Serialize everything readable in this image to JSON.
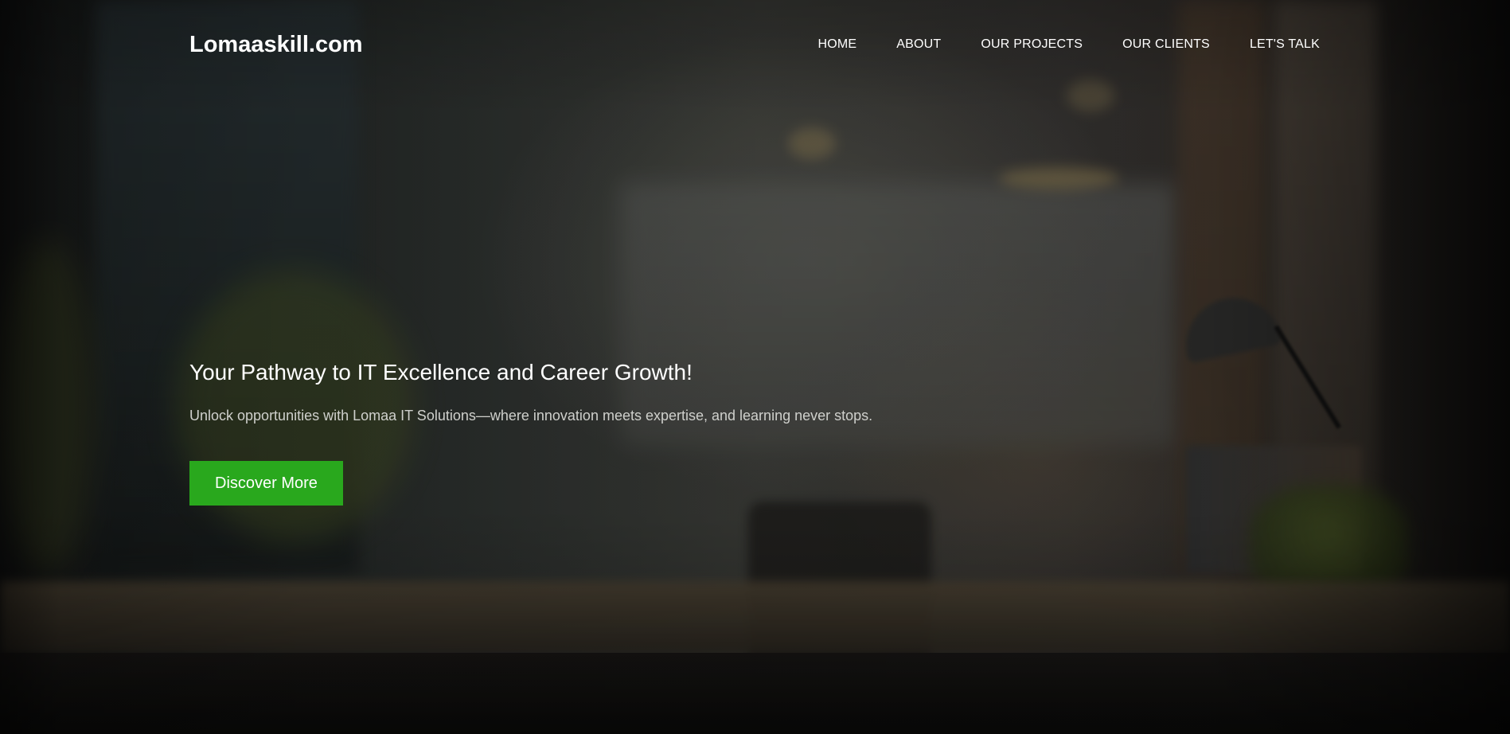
{
  "header": {
    "brand": "Lomaaskill.com",
    "nav": [
      {
        "label": "HOME"
      },
      {
        "label": "ABOUT"
      },
      {
        "label": "OUR PROJECTS"
      },
      {
        "label": "OUR CLIENTS"
      },
      {
        "label": "LET'S TALK"
      }
    ]
  },
  "hero": {
    "headline": "Your Pathway to IT Excellence and Career Growth!",
    "subtext": "Unlock opportunities with Lomaa IT Solutions—where innovation meets expertise, and learning never stops.",
    "cta_label": "Discover More"
  },
  "colors": {
    "accent": "#29a81d",
    "text": "#ffffff",
    "subtext": "#cfd0cc"
  }
}
